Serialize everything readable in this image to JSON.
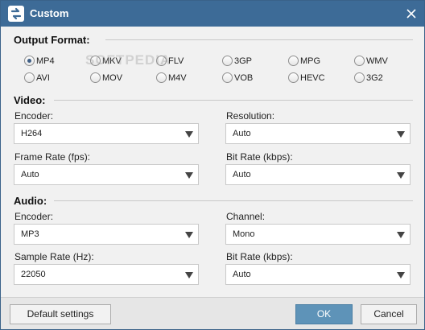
{
  "window": {
    "title": "Custom"
  },
  "output_format": {
    "label": "Output Format:",
    "selected": "MP4",
    "options_row1": [
      "MP4",
      "MKV",
      "FLV",
      "3GP",
      "MPG",
      "WMV"
    ],
    "options_row2": [
      "AVI",
      "MOV",
      "M4V",
      "VOB",
      "HEVC",
      "3G2"
    ]
  },
  "video": {
    "label": "Video:",
    "encoder_label": "Encoder:",
    "encoder_value": "H264",
    "resolution_label": "Resolution:",
    "resolution_value": "Auto",
    "frame_rate_label": "Frame Rate (fps):",
    "frame_rate_value": "Auto",
    "bit_rate_label": "Bit Rate (kbps):",
    "bit_rate_value": "Auto"
  },
  "audio": {
    "label": "Audio:",
    "encoder_label": "Encoder:",
    "encoder_value": "MP3",
    "channel_label": "Channel:",
    "channel_value": "Mono",
    "sample_rate_label": "Sample Rate (Hz):",
    "sample_rate_value": "22050",
    "bit_rate_label": "Bit Rate (kbps):",
    "bit_rate_value": "Auto"
  },
  "footer": {
    "default_label": "Default settings",
    "ok_label": "OK",
    "cancel_label": "Cancel"
  },
  "watermark": "SOFTPEDIA",
  "colors": {
    "titlebar": "#3d6b97",
    "primary_button": "#5e93b8",
    "background": "#f1f1f1"
  }
}
